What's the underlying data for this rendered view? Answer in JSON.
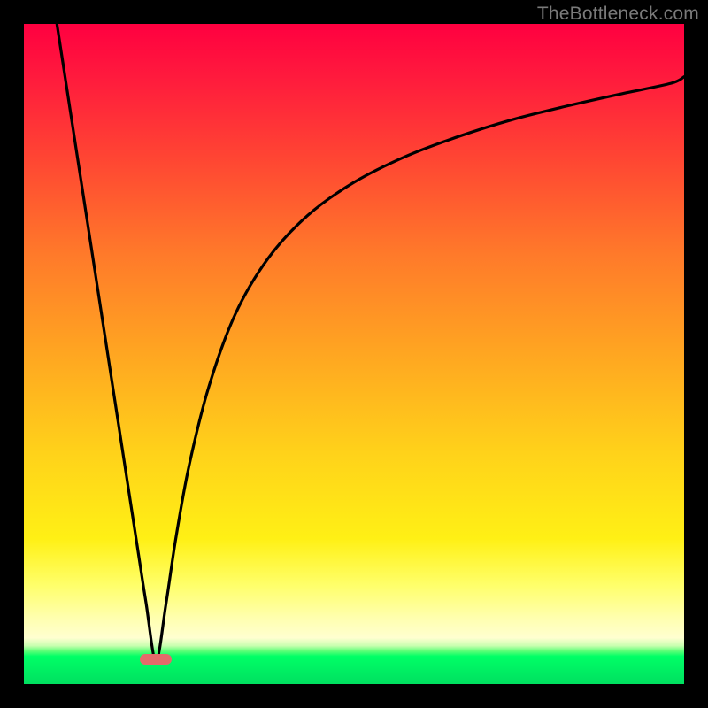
{
  "watermark": {
    "text": "TheBottleneck.com"
  },
  "marker": {
    "color": "#e46a6a",
    "x_pct": 20.0,
    "y_pct": 96.3
  },
  "chart_data": {
    "type": "line",
    "title": "",
    "xlabel": "",
    "ylabel": "",
    "xlim": [
      0,
      100
    ],
    "ylim": [
      0,
      100
    ],
    "grid": false,
    "legend": false,
    "annotations": [
      "TheBottleneck.com"
    ],
    "notes": "Axes are unlabeled in the source image; x and y are reported as 0–100 percentages of the plot extent. The curve is a V/J-shape: a steep linear descent from the top-left to a minimum near x≈20, then a concave-down rise toward the upper-right that flattens out around y≈92.",
    "series": [
      {
        "name": "curve",
        "x": [
          5,
          8,
          11,
          14,
          17,
          18.5,
          20,
          21.5,
          23,
          25,
          28,
          32,
          37,
          43,
          50,
          58,
          66,
          74,
          82,
          90,
          98,
          100
        ],
        "y": [
          100,
          80.5,
          61,
          41.5,
          22,
          12.3,
          3.5,
          12,
          22,
          33,
          45,
          56,
          64.5,
          71,
          76,
          80,
          83,
          85.5,
          87.5,
          89.3,
          91,
          92
        ]
      }
    ],
    "marker": {
      "x": 20,
      "y": 3.5,
      "shape": "pill",
      "color": "#e46a6a"
    },
    "background_gradient": {
      "direction": "top-to-bottom",
      "stops": [
        {
          "pos": 0.0,
          "color": "#ff0040"
        },
        {
          "pos": 0.5,
          "color": "#ffa621"
        },
        {
          "pos": 0.85,
          "color": "#ffff6a"
        },
        {
          "pos": 0.95,
          "color": "#5dff77"
        },
        {
          "pos": 1.0,
          "color": "#00e060"
        }
      ]
    }
  }
}
